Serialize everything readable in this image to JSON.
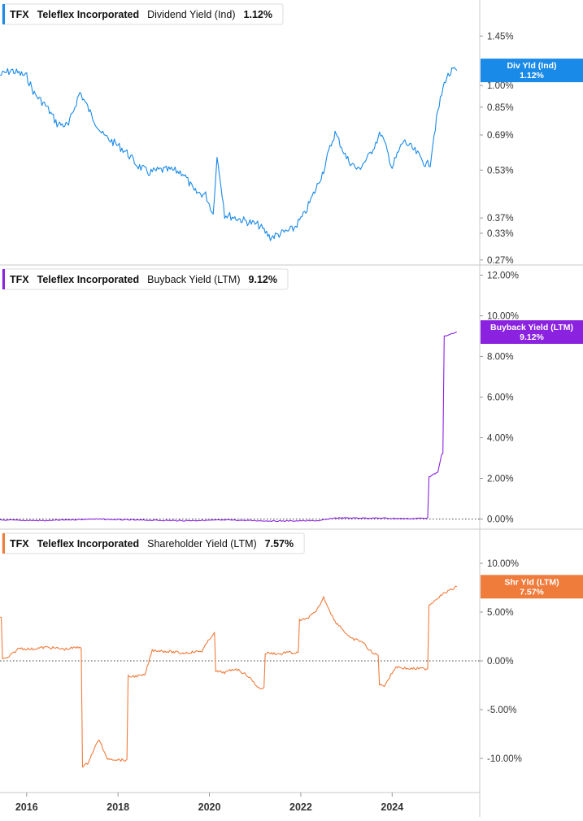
{
  "chart_data": [
    {
      "type": "line",
      "panel_id": "dividend",
      "ticker": "TFX",
      "company": "Teleflex Incorporated",
      "metric": "Dividend Yield (Ind)",
      "last_value": "1.12%",
      "badge_label": "Div Yld (Ind)",
      "badge_value": "1.12%",
      "color": "#1a8ae8",
      "y_scale": "log",
      "ylim": [
        0.26,
        1.9
      ],
      "y_ticks": [
        {
          "value": 1.45,
          "label": "1.45%"
        },
        {
          "value": 1.0,
          "label": "1.00%"
        },
        {
          "value": 0.85,
          "label": "0.85%"
        },
        {
          "value": 0.69,
          "label": "0.69%"
        },
        {
          "value": 0.53,
          "label": "0.53%"
        },
        {
          "value": 0.37,
          "label": "0.37%"
        },
        {
          "value": 0.33,
          "label": "0.33%"
        },
        {
          "value": 0.27,
          "label": "0.27%"
        }
      ],
      "x": [
        "2015-06",
        "2015-09",
        "2016-01",
        "2016-03",
        "2016-06",
        "2016-09",
        "2016-12",
        "2017-03",
        "2017-06",
        "2017-09",
        "2017-12",
        "2018-03",
        "2018-06",
        "2018-09",
        "2018-12",
        "2019-03",
        "2019-06",
        "2019-09",
        "2019-12",
        "2020-02",
        "2020-03",
        "2020-05",
        "2020-08",
        "2020-11",
        "2021-02",
        "2021-05",
        "2021-08",
        "2021-11",
        "2022-02",
        "2022-05",
        "2022-07",
        "2022-10",
        "2023-01",
        "2023-04",
        "2023-07",
        "2023-10",
        "2024-01",
        "2024-04",
        "2024-07",
        "2024-10",
        "2024-11",
        "2025-01",
        "2025-03",
        "2025-05",
        "2025-06"
      ],
      "values": [
        1.08,
        1.12,
        1.07,
        0.94,
        0.86,
        0.75,
        0.74,
        0.95,
        0.8,
        0.69,
        0.65,
        0.61,
        0.55,
        0.52,
        0.53,
        0.53,
        0.52,
        0.45,
        0.44,
        0.38,
        0.58,
        0.38,
        0.37,
        0.36,
        0.35,
        0.32,
        0.33,
        0.34,
        0.38,
        0.46,
        0.53,
        0.7,
        0.58,
        0.53,
        0.59,
        0.7,
        0.54,
        0.66,
        0.61,
        0.55,
        0.56,
        0.82,
        1.05,
        1.12,
        1.12
      ]
    },
    {
      "type": "line",
      "panel_id": "buyback",
      "ticker": "TFX",
      "company": "Teleflex Incorporated",
      "metric": "Buyback Yield (LTM)",
      "last_value": "9.12%",
      "badge_label": "Buyback Yield (LTM)",
      "badge_value": "9.12%",
      "color": "#8a22e0",
      "y_scale": "linear",
      "ylim": [
        -0.5,
        12.5
      ],
      "y_ticks": [
        {
          "value": 12,
          "label": "12.00%"
        },
        {
          "value": 10,
          "label": "10.00%"
        },
        {
          "value": 8,
          "label": "8.00%"
        },
        {
          "value": 6,
          "label": "6.00%"
        },
        {
          "value": 4,
          "label": "4.00%"
        },
        {
          "value": 2,
          "label": "2.00%"
        },
        {
          "value": 0,
          "label": "0.00%"
        }
      ],
      "x": [
        "2015-06",
        "2016-06",
        "2017-06",
        "2018-06",
        "2019-06",
        "2020-06",
        "2021-06",
        "2022-06",
        "2022-10",
        "2023-06",
        "2024-06",
        "2024-10",
        "2024-11",
        "2025-01",
        "2025-02",
        "2025-03",
        "2025-06"
      ],
      "values": [
        -0.05,
        -0.08,
        0.0,
        -0.05,
        -0.08,
        -0.05,
        -0.1,
        -0.08,
        0.05,
        0.05,
        0.02,
        0.05,
        2.1,
        2.3,
        3.2,
        9.0,
        9.2
      ]
    },
    {
      "type": "line",
      "panel_id": "shareholder",
      "ticker": "TFX",
      "company": "Teleflex Incorporated",
      "metric": "Shareholder Yield (LTM)",
      "last_value": "7.57%",
      "badge_label": "Shr Yld (LTM)",
      "badge_value": "7.57%",
      "color": "#f07c3c",
      "y_scale": "linear",
      "ylim": [
        -13.5,
        13.5
      ],
      "y_ticks": [
        {
          "value": 10,
          "label": "10.00%"
        },
        {
          "value": 5,
          "label": "5.00%"
        },
        {
          "value": 0,
          "label": "0.00%"
        },
        {
          "value": -5,
          "label": "-5.00%"
        },
        {
          "value": -10,
          "label": "-10.00%"
        }
      ],
      "x": [
        "2015-06",
        "2015-07",
        "2015-08",
        "2015-11",
        "2016-02",
        "2016-06",
        "2016-11",
        "2017-03",
        "2017-04",
        "2017-05",
        "2017-08",
        "2017-10",
        "2018-03",
        "2018-04",
        "2018-08",
        "2018-10",
        "2019-01",
        "2019-06",
        "2019-11",
        "2020-02",
        "2020-03",
        "2020-05",
        "2020-08",
        "2020-11",
        "2021-02",
        "2021-05",
        "2021-08",
        "2021-09",
        "2021-11",
        "2022-02",
        "2022-05",
        "2022-07",
        "2022-10",
        "2022-11",
        "2023-02",
        "2023-05",
        "2023-08",
        "2023-11",
        "2024-02",
        "2024-05",
        "2024-08",
        "2024-10",
        "2024-11",
        "2025-01",
        "2025-03",
        "2025-06"
      ],
      "values": [
        4.5,
        0.2,
        0.3,
        1.3,
        1.2,
        1.4,
        1.2,
        1.4,
        -10.8,
        -10.5,
        -8.0,
        -10.0,
        -10.2,
        -1.6,
        -1.5,
        1.1,
        1.0,
        0.8,
        1.0,
        2.8,
        -1.1,
        -1.2,
        -0.8,
        -1.5,
        -2.8,
        0.8,
        0.7,
        0.9,
        0.8,
        4.2,
        5.0,
        6.5,
        4.0,
        3.7,
        2.3,
        2.0,
        0.7,
        -2.5,
        -0.6,
        -0.8,
        -0.8,
        -0.8,
        5.8,
        6.5,
        7.0,
        7.6
      ]
    }
  ],
  "x_axis": {
    "ticks": [
      {
        "value": "2016-01",
        "label": "2016"
      },
      {
        "value": "2018-01",
        "label": "2018"
      },
      {
        "value": "2020-01",
        "label": "2020"
      },
      {
        "value": "2022-01",
        "label": "2022"
      },
      {
        "value": "2024-01",
        "label": "2024"
      }
    ],
    "range": [
      "2015-06",
      "2025-12"
    ]
  }
}
